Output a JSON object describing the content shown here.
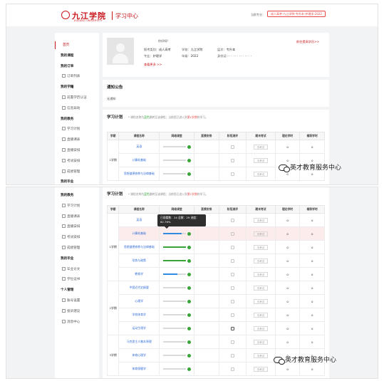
{
  "header": {
    "logo_cn": "九江学院",
    "logo_en": "JIUJIANG UNIVERSITY",
    "title": "学习中心",
    "current_label": "当前专业：",
    "current_major": "成人高考-九江学院-专升本-护理学-2022"
  },
  "sidebar1": [
    {
      "label": "首页",
      "kind": "active"
    },
    {
      "label": "我的课程",
      "kind": "group"
    },
    {
      "label": "我的订单",
      "kind": "group"
    },
    {
      "label": "订单列表",
      "kind": "sub"
    },
    {
      "label": "我的学籍",
      "kind": "group"
    },
    {
      "label": "前置学历认证",
      "kind": "sub"
    },
    {
      "label": "信息异动",
      "kind": "sub"
    },
    {
      "label": "我的教务",
      "kind": "group"
    },
    {
      "label": "学习计划",
      "kind": "sub"
    },
    {
      "label": "直播课表",
      "kind": "sub"
    },
    {
      "label": "直播安排",
      "kind": "sub"
    },
    {
      "label": "考试安排",
      "kind": "sub"
    },
    {
      "label": "成绩管理",
      "kind": "sub"
    },
    {
      "label": "我的毕业",
      "kind": "group"
    }
  ],
  "sidebar2": [
    {
      "label": "我的教务",
      "kind": "group"
    },
    {
      "label": "学习计划",
      "kind": "sub"
    },
    {
      "label": "直播课表",
      "kind": "sub"
    },
    {
      "label": "直播安排",
      "kind": "sub"
    },
    {
      "label": "考试安排",
      "kind": "sub"
    },
    {
      "label": "成绩管理",
      "kind": "sub"
    },
    {
      "label": "我的毕业",
      "kind": "group"
    },
    {
      "label": "毕业论文",
      "kind": "sub"
    },
    {
      "label": "学位证书",
      "kind": "sub"
    },
    {
      "label": "个人管理",
      "kind": "group"
    },
    {
      "label": "账号设置",
      "kind": "sub"
    },
    {
      "label": "投诉建议",
      "kind": "sub"
    },
    {
      "label": "消息中心",
      "kind": "sub"
    }
  ],
  "profile": {
    "greeting": "你好呀!",
    "type_label": "报考类别：",
    "type_value": "成人高考",
    "school_label": "学校：",
    "school_value": "九江学院",
    "level_label": "层次：",
    "level_value": "专升本",
    "major_label": "专业：",
    "major_value": "护理学",
    "year_label": "年级：",
    "year_value": "2022",
    "id_label": "身份证：",
    "id_value": "· · · · · · · · · · · · ·",
    "more": "查看更多 >>",
    "upgrade": "前往提高学历>>"
  },
  "notice": {
    "title": "通知公告",
    "empty": "无通知"
  },
  "plan": {
    "title": "学习计划",
    "hint_a": "* 课程名称为",
    "hint_blue": "蓝色",
    "hint_b": "跳转至该课程；当前您已进入到",
    "hint_red": "第1学期",
    "hint_c": "的学习。"
  },
  "table": {
    "headers": [
      "学期",
      "课程名称",
      "网络课堂",
      "直播安排",
      "阶段测评",
      "期末考试",
      "理论学时",
      "辅导学时"
    ]
  },
  "rows1": [
    {
      "course": "英语",
      "theory": "0",
      "tutor": "0"
    },
    {
      "course": "计算机基础",
      "theory": "0",
      "tutor": "0"
    },
    {
      "course": "思想道德修养与法律基础",
      "theory": "0",
      "tutor": "0"
    }
  ],
  "term1": "1学期",
  "rows2": [
    {
      "term": "1学期",
      "course": "英语",
      "theory": "0",
      "tutor": "0",
      "progress": 0,
      "edit": "light"
    },
    {
      "course": "计算机基础",
      "theory": "0",
      "tutor": "0",
      "progress": 0.83,
      "edit": "light",
      "highlight": true
    },
    {
      "course": "思想道德修养与法律基础",
      "theory": "0",
      "tutor": "0",
      "progress": 1,
      "edit": "light"
    },
    {
      "course": "形势与政策",
      "theory": "0",
      "tutor": "0",
      "progress": 1,
      "edit": "light"
    },
    {
      "course": "教育学",
      "theory": "0",
      "tutor": "0",
      "progress": 0.65,
      "edit": "light"
    },
    {
      "term": "2学期",
      "course": "中国近代史纲要",
      "theory": "0",
      "tutor": "0",
      "progress": 0,
      "edit": "light"
    },
    {
      "course": "心理学",
      "theory": "0",
      "tutor": "0",
      "progress": 0,
      "edit": "light"
    },
    {
      "course": "学校体育学",
      "theory": "0",
      "tutor": "0",
      "progress": 0,
      "edit": "light"
    },
    {
      "course": "运动生理学",
      "theory": "0",
      "tutor": "0",
      "progress": 0,
      "edit": "dark"
    },
    {
      "term": "3学期",
      "course": "马克思主义基本原理",
      "theory": "0",
      "tutor": "0",
      "progress": 0,
      "edit": "light"
    },
    {
      "course": "体育心理学",
      "theory": "0",
      "tutor": "0",
      "progress": 0,
      "edit": "light"
    },
    {
      "course": "体育保健学",
      "theory": "0",
      "tutor": "0",
      "progress": 0,
      "edit": "light"
    }
  ],
  "row_button": "去考试",
  "tooltip": "已观看数：24 总数：29 进度：82.76%",
  "watermark": "英才教育服务中心",
  "colors": {
    "brand": "#c8161d",
    "progress_green": "#39a539",
    "progress_blue": "#2f8ae0",
    "link_blue": "#2f6bd8"
  }
}
